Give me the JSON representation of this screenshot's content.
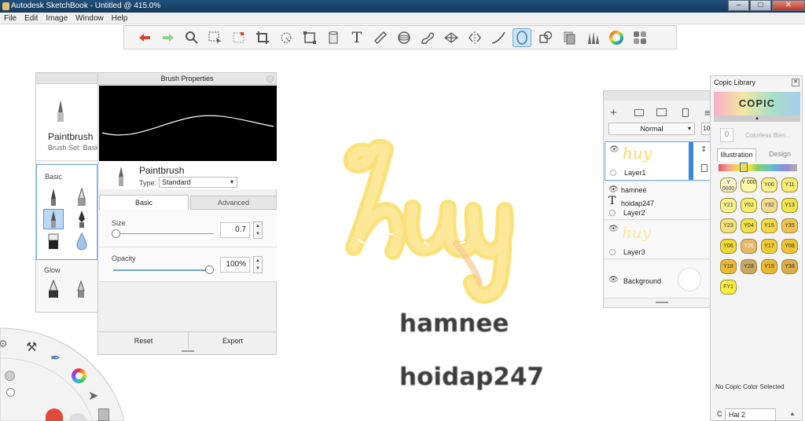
{
  "window": {
    "title": "Autodesk SketchBook - Untitled @ 415.0%",
    "min": "–",
    "max": "□",
    "close": "✕"
  },
  "menu": [
    "File",
    "Edit",
    "Image",
    "Window",
    "Help"
  ],
  "toolbar": {
    "icons": [
      "undo-icon",
      "redo-icon",
      "zoom-icon",
      "select-icon",
      "select-dashed-icon",
      "crop-icon",
      "lasso-icon",
      "transform-icon",
      "fill-icon",
      "text-icon",
      "ruler-icon",
      "ellipse-guide-icon",
      "french-curve-icon",
      "perspective-icon",
      "symmetry-icon",
      "stroke-icon",
      "ellipse-tool-icon",
      "shape-icon",
      "copy-icon",
      "brushes-icon",
      "color-wheel-icon",
      "palette-icon"
    ],
    "text_glyph": "T"
  },
  "brush_sidebar": {
    "brush_name": "Paintbrush",
    "brush_set": "Brush Set: Basic",
    "section_basic": "Basic",
    "section_glow": "Glow"
  },
  "brush_properties": {
    "title": "Brush Properties",
    "name": "Paintbrush",
    "type_label": "Type:",
    "type_value": "Standard",
    "tab_basic": "Basic",
    "tab_advanced": "Advanced",
    "size_label": "Size",
    "size_value": "0.7",
    "opacity_label": "Opacity",
    "opacity_value": "100%",
    "opacity_fraction": 1.0,
    "size_fraction": 0.02,
    "reset": "Reset",
    "export": "Export"
  },
  "layers": {
    "blend_mode": "Normal",
    "opacity": "100",
    "items": [
      {
        "name": "Layer1",
        "thumb": "huy"
      },
      {
        "name": "hamnee"
      },
      {
        "name": "hoidap247",
        "sub": "Layer2"
      },
      {
        "name": "Layer3",
        "thumb": "huy"
      },
      {
        "name": "Background"
      }
    ]
  },
  "copic": {
    "title": "Copic Library",
    "logo": "COPIC",
    "color_search": "Colorless Blen...",
    "color_num": "0",
    "tab_illustration": "Illustration",
    "tab_design": "Design",
    "swatches": [
      [
        "Y 0000",
        "Y 000",
        "Y00",
        "Y11"
      ],
      [
        "Y21",
        "Y02",
        "Y32",
        "Y13"
      ],
      [
        "Y23",
        "Y04",
        "Y15",
        "Y35"
      ],
      [
        "Y06",
        "Y26",
        "Y17",
        "Y08"
      ],
      [
        "Y18",
        "Y28",
        "Y19",
        "Y38"
      ],
      [
        "FY1"
      ]
    ],
    "swatch_colors": [
      [
        "#fbf9c8",
        "#fbf6a8",
        "#f8f08c",
        "#f6ec74"
      ],
      [
        "#f8f28c",
        "#f7ee6a",
        "#f2dc90",
        "#f4e24a"
      ],
      [
        "#f3e27a",
        "#f3e046",
        "#f3d842",
        "#f0c452"
      ],
      [
        "#f1d936",
        "#e8b86a",
        "#f0cc32",
        "#eec430"
      ],
      [
        "#ebb832",
        "#caa860",
        "#e9b82e",
        "#dcae4a"
      ],
      [
        "#f7ef3c"
      ]
    ],
    "no_color": "No Copic Color Selected",
    "bottom_tab": "Hai 2",
    "bottom_prefix": "C"
  },
  "canvas": {
    "word": "huy",
    "line1": "hamnee",
    "line2": "hoidap247"
  },
  "colors": {
    "accent": "#6fa6d8",
    "yellow": "#fbd85a",
    "title_bar": "#1f4f7a"
  }
}
